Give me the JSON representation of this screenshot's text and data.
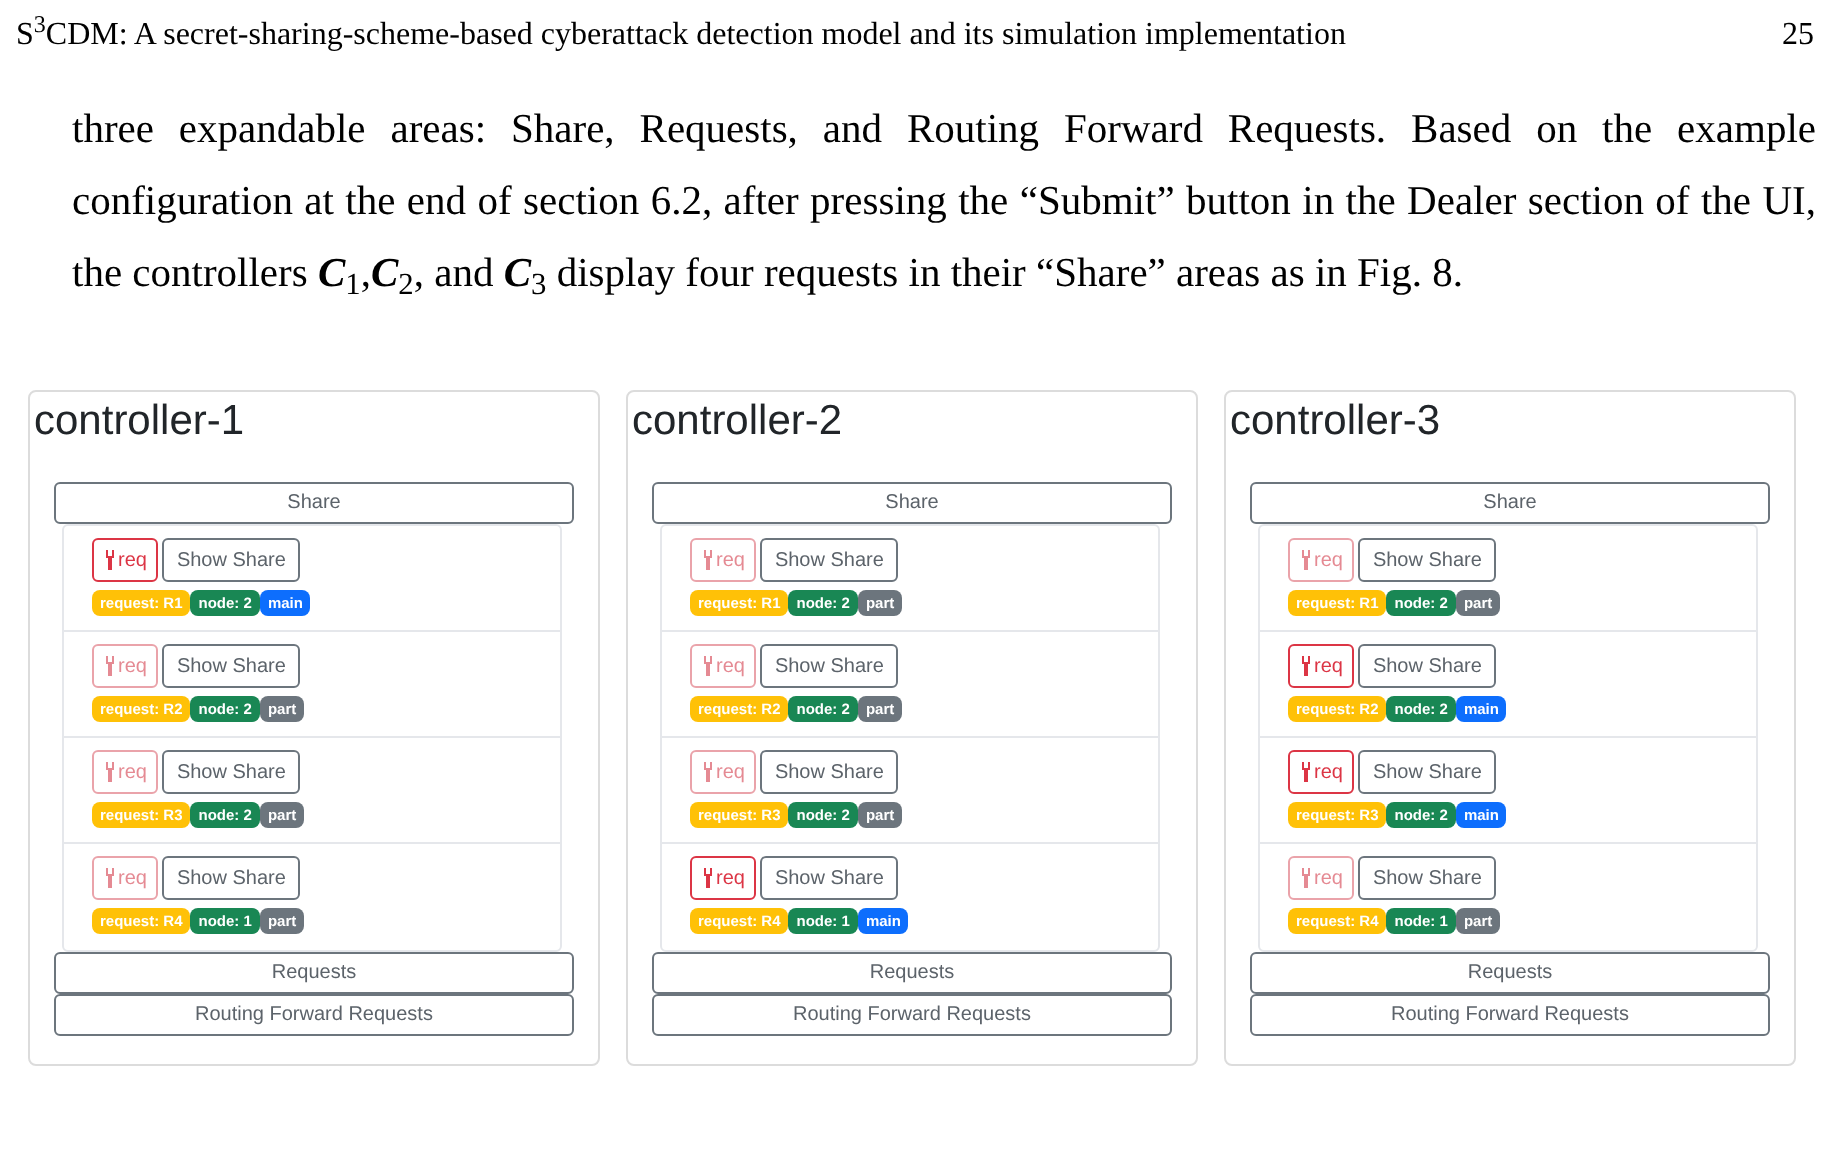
{
  "page_header": {
    "title": "S$^{3}$CDM: A secret-sharing-scheme-based cyberattack detection model and its simulation implementation",
    "page_number": "25"
  },
  "paragraph": "three expandable areas: Share, Requests, and Routing Forward Requests. Based on the example configuration at the end of section 6.2, after pressing the “Submit” button in the Dealer section of the UI, the controllers **C**$_{1}$,**C**$_{2}$, and **C**$_{3}$ display four requests in their “Share” areas as in Fig. 8.",
  "controllers": [
    {
      "title": "controller-1",
      "sections": [
        "Share",
        "Requests",
        "Routing Forward Requests"
      ],
      "requests": [
        {
          "req_button": "req",
          "req_disabled": false,
          "show_button": "Show Share",
          "badges": [
            {
              "text": "request: R1",
              "color": "#ffc107"
            },
            {
              "text": "node: 2",
              "color": "#198754"
            },
            {
              "text": "main",
              "color": "#0d6efd"
            }
          ]
        },
        {
          "req_button": "req",
          "req_disabled": true,
          "show_button": "Show Share",
          "badges": [
            {
              "text": "request: R2",
              "color": "#ffc107"
            },
            {
              "text": "node: 2",
              "color": "#198754"
            },
            {
              "text": "part",
              "color": "#6c757d"
            }
          ]
        },
        {
          "req_button": "req",
          "req_disabled": true,
          "show_button": "Show Share",
          "badges": [
            {
              "text": "request: R3",
              "color": "#ffc107"
            },
            {
              "text": "node: 2",
              "color": "#198754"
            },
            {
              "text": "part",
              "color": "#6c757d"
            }
          ]
        },
        {
          "req_button": "req",
          "req_disabled": true,
          "show_button": "Show Share",
          "badges": [
            {
              "text": "request: R4",
              "color": "#ffc107"
            },
            {
              "text": "node: 1",
              "color": "#198754"
            },
            {
              "text": "part",
              "color": "#6c757d"
            }
          ]
        }
      ]
    },
    {
      "title": "controller-2",
      "sections": [
        "Share",
        "Requests",
        "Routing Forward Requests"
      ],
      "requests": [
        {
          "req_button": "req",
          "req_disabled": true,
          "show_button": "Show Share",
          "badges": [
            {
              "text": "request: R1",
              "color": "#ffc107"
            },
            {
              "text": "node: 2",
              "color": "#198754"
            },
            {
              "text": "part",
              "color": "#6c757d"
            }
          ]
        },
        {
          "req_button": "req",
          "req_disabled": true,
          "show_button": "Show Share",
          "badges": [
            {
              "text": "request: R2",
              "color": "#ffc107"
            },
            {
              "text": "node: 2",
              "color": "#198754"
            },
            {
              "text": "part",
              "color": "#6c757d"
            }
          ]
        },
        {
          "req_button": "req",
          "req_disabled": true,
          "show_button": "Show Share",
          "badges": [
            {
              "text": "request: R3",
              "color": "#ffc107"
            },
            {
              "text": "node: 2",
              "color": "#198754"
            },
            {
              "text": "part",
              "color": "#6c757d"
            }
          ]
        },
        {
          "req_button": "req",
          "req_disabled": false,
          "show_button": "Show Share",
          "badges": [
            {
              "text": "request: R4",
              "color": "#ffc107"
            },
            {
              "text": "node: 1",
              "color": "#198754"
            },
            {
              "text": "main",
              "color": "#0d6efd"
            }
          ]
        }
      ]
    },
    {
      "title": "controller-3",
      "sections": [
        "Share",
        "Requests",
        "Routing Forward Requests"
      ],
      "requests": [
        {
          "req_button": "req",
          "req_disabled": true,
          "show_button": "Show Share",
          "badges": [
            {
              "text": "request: R1",
              "color": "#ffc107"
            },
            {
              "text": "node: 2",
              "color": "#198754"
            },
            {
              "text": "part",
              "color": "#6c757d"
            }
          ]
        },
        {
          "req_button": "req",
          "req_disabled": false,
          "show_button": "Show Share",
          "badges": [
            {
              "text": "request: R2",
              "color": "#ffc107"
            },
            {
              "text": "node: 2",
              "color": "#198754"
            },
            {
              "text": "main",
              "color": "#0d6efd"
            }
          ]
        },
        {
          "req_button": "req",
          "req_disabled": false,
          "show_button": "Show Share",
          "badges": [
            {
              "text": "request: R3",
              "color": "#ffc107"
            },
            {
              "text": "node: 2",
              "color": "#198754"
            },
            {
              "text": "main",
              "color": "#0d6efd"
            }
          ]
        },
        {
          "req_button": "req",
          "req_disabled": true,
          "show_button": "Show Share",
          "badges": [
            {
              "text": "request: R4",
              "color": "#ffc107"
            },
            {
              "text": "node: 1",
              "color": "#198754"
            },
            {
              "text": "part",
              "color": "#6c757d"
            }
          ]
        }
      ]
    }
  ]
}
